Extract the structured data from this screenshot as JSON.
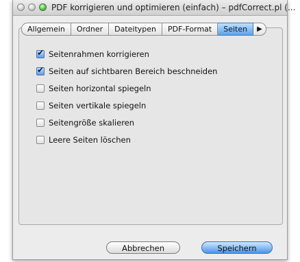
{
  "window": {
    "title": "PDF korrigieren und optimieren (einfach) – pdfCorrect.pl (..."
  },
  "tabs": [
    {
      "label": "Allgemein",
      "active": false
    },
    {
      "label": "Ordner",
      "active": false
    },
    {
      "label": "Dateitypen",
      "active": false
    },
    {
      "label": "PDF-Format",
      "active": false
    },
    {
      "label": "Seiten",
      "active": true
    },
    {
      "label": "▶",
      "active": false
    }
  ],
  "options": [
    {
      "label": "Seitenrahmen korrigieren",
      "checked": true
    },
    {
      "label": "Seiten auf sichtbaren Bereich beschneiden",
      "checked": true
    },
    {
      "label": "Seiten horizontal spiegeln",
      "checked": false
    },
    {
      "label": "Seiten vertikale spiegeln",
      "checked": false
    },
    {
      "label": "Seitengröße skalieren",
      "checked": false
    },
    {
      "label": "Leere Seiten löschen",
      "checked": false
    }
  ],
  "buttons": {
    "cancel": "Abbrechen",
    "save": "Speichern"
  },
  "colors": {
    "accent": "#5aa2ea",
    "window_bg": "#ececec"
  }
}
